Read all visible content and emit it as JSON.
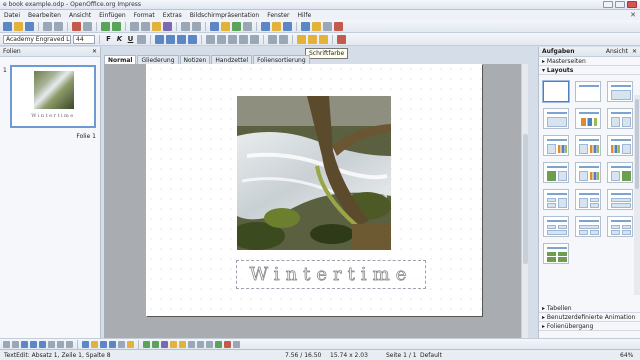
{
  "window": {
    "title": "e book example.odp - OpenOffice.org Impress"
  },
  "menu": [
    "Datei",
    "Bearbeiten",
    "Ansicht",
    "Einfügen",
    "Format",
    "Extras",
    "Bildschirmpräsentation",
    "Fenster",
    "Hilfe"
  ],
  "formatbar": {
    "font_name": "Academy Engraved LET",
    "font_size": "44",
    "bold": "F",
    "italic": "K",
    "underline": "U"
  },
  "tooltip": "Schriftfarbe",
  "slides_panel": {
    "title": "Folien",
    "slide_number": "1",
    "thumb_caption": "Wintertime",
    "slide_label": "Folie 1"
  },
  "view_tabs": [
    "Normal",
    "Gliederung",
    "Notizen",
    "Handzettel",
    "Foliensortierung"
  ],
  "slide": {
    "title_text": "Wintertime"
  },
  "tasks_panel": {
    "title": "Aufgaben",
    "view_label": "Ansicht",
    "sections": {
      "master": "Masterseiten",
      "layouts": "Layouts",
      "tables": "Tabellen",
      "animation": "Benutzerdefinierte Animation",
      "transition": "Folienübergang"
    }
  },
  "status": {
    "edit": "TextEdit: Absatz 1, Zeile 1, Spalte 8",
    "position": "7.56 / 16.50",
    "size": "15.74 x 2.03",
    "slide": "Seite 1 / 1",
    "layout": "Default",
    "zoom": "64%"
  }
}
